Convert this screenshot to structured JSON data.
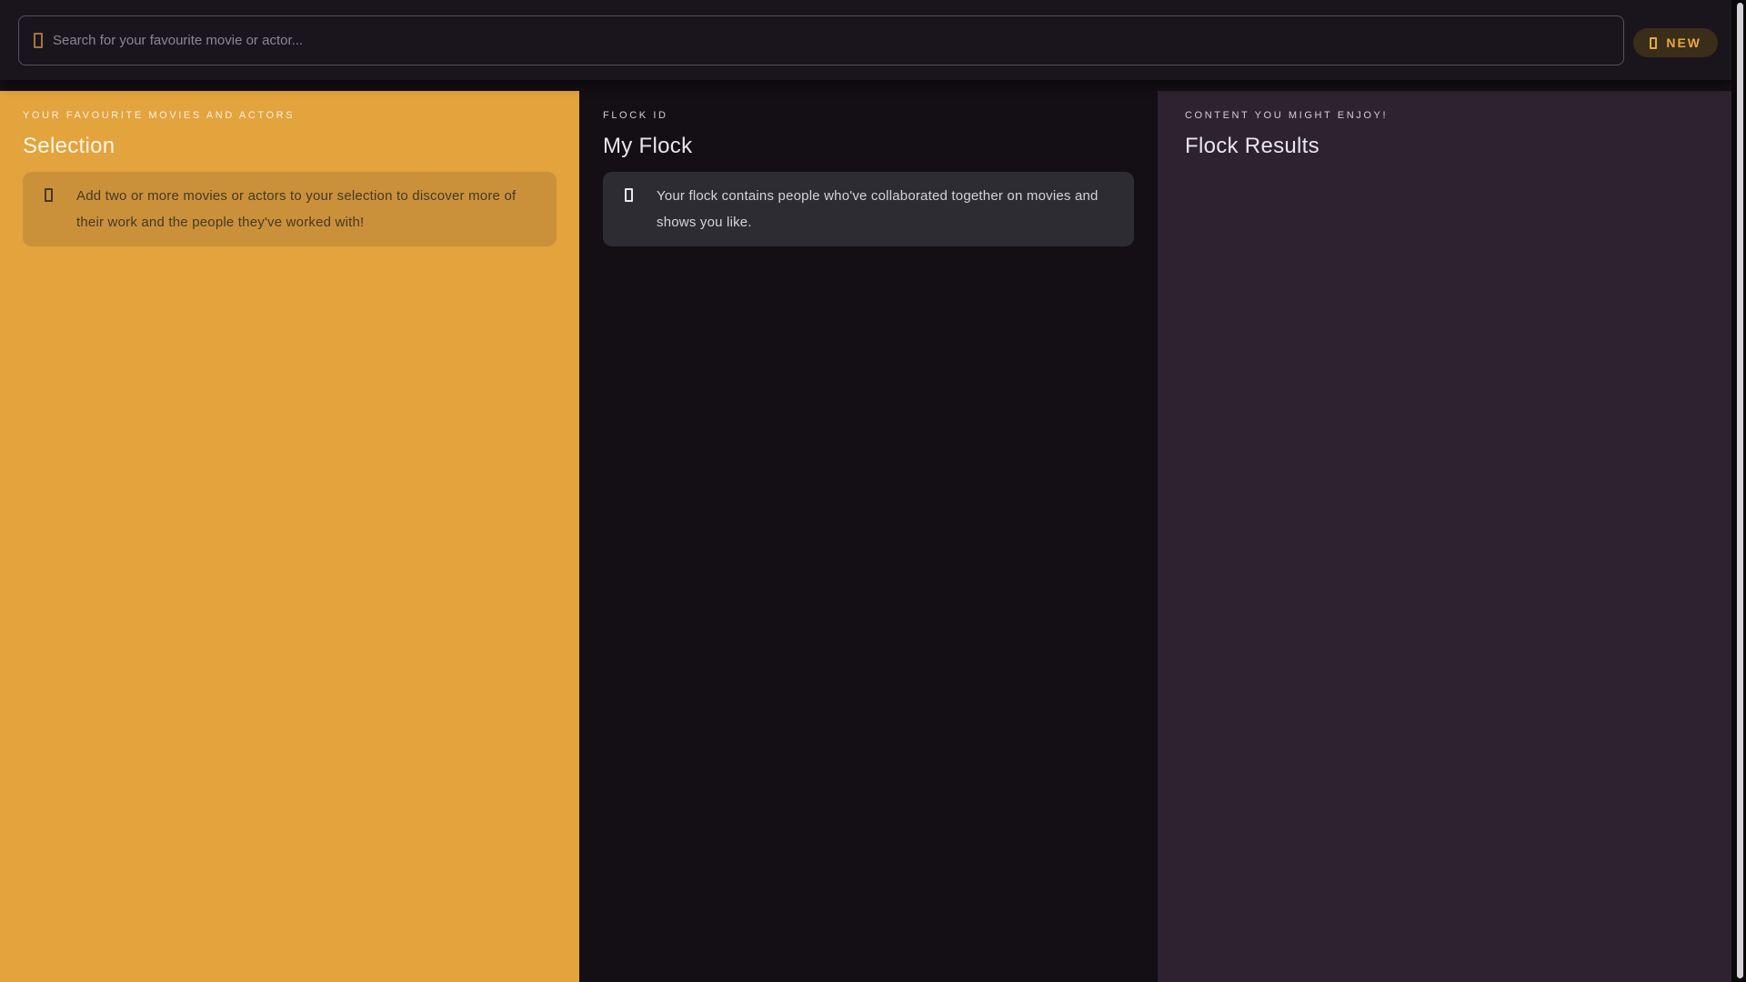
{
  "topbar": {
    "search": {
      "placeholder": "Search for your favourite movie or actor...",
      "icon": "search-icon"
    },
    "new_button": {
      "label": "NEW",
      "icon": "new-icon"
    }
  },
  "columns": {
    "selection": {
      "eyebrow": "YOUR FAVOURITE MOVIES AND ACTORS",
      "title": "Selection",
      "info_icon": "info-icon",
      "info": "Add two or more movies or actors to your selection to discover more of their work and the people they've worked with!"
    },
    "flock": {
      "eyebrow": "FLOCK ID",
      "title": "My Flock",
      "info_icon": "info-icon",
      "info": "Your flock contains people who've collaborated together on movies and shows you like."
    },
    "results": {
      "eyebrow": "CONTENT YOU MIGHT ENJOY!",
      "title": "Flock Results"
    }
  },
  "palette": {
    "accent_orange": "#e3a33d",
    "selection_infobox_bg": "#cb913a",
    "selection_text_dark": "#443827",
    "flock_infobox_bg": "#2e2c33",
    "results_panel_bg": "#2c2230",
    "topbar_bg": "#1a141c",
    "page_bg": "#140f15",
    "new_button_bg": "#3a2d1a",
    "new_button_text": "#eaa83f",
    "scrollbar_thumb": "#d7d4d9"
  }
}
